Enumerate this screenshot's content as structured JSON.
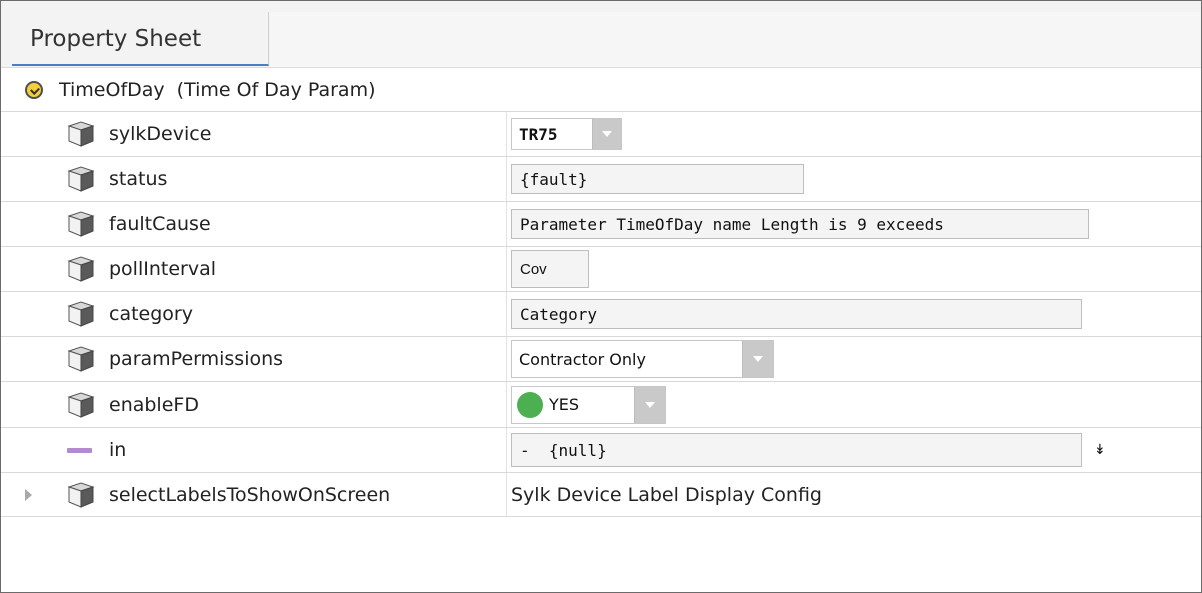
{
  "tab": {
    "title": "Property Sheet"
  },
  "header": {
    "name": "TimeOfDay",
    "type": "(Time Of Day Param)"
  },
  "rows": [
    {
      "name": "sylkDevice",
      "value": "TR75",
      "kind": "select"
    },
    {
      "name": "status",
      "value": "{fault}",
      "kind": "field"
    },
    {
      "name": "faultCause",
      "value": "Parameter TimeOfDay name Length is 9 exceeds",
      "kind": "field"
    },
    {
      "name": "pollInterval",
      "value": "Cov",
      "kind": "field"
    },
    {
      "name": "category",
      "value": "Category",
      "kind": "field"
    },
    {
      "name": "paramPermissions",
      "value": "Contractor Only",
      "kind": "select"
    },
    {
      "name": "enableFD",
      "value": "YES",
      "kind": "select"
    },
    {
      "name": "in",
      "value": "-  {null}",
      "kind": "field"
    },
    {
      "name": "selectLabelsToShowOnScreen",
      "value": "Sylk Device Label Display Config",
      "kind": "text"
    }
  ],
  "icons": {
    "header": "clock-icon",
    "slot": "slot-cube-icon",
    "link": "link-icon",
    "expand": "expand-down-icon",
    "tree": "tree-expand-arrow-icon"
  },
  "colors": {
    "tab_underline": "#4a7fc1",
    "yes_indicator": "#4caf50",
    "link_slot": "#b28ad0",
    "clock": "#f3cf39"
  },
  "expand_glyph": "↡"
}
